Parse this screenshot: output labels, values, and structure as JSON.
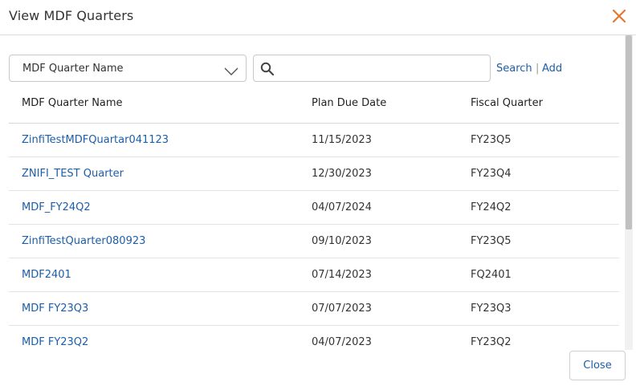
{
  "dialog": {
    "title": "View MDF Quarters",
    "close_icon": "close-x-icon",
    "accent_color": "#e8772e",
    "link_color": "#1c5ea8"
  },
  "filter": {
    "field_select": {
      "selected": "MDF Quarter Name",
      "icon": "chevron-down-icon"
    },
    "search_input": {
      "value": "",
      "placeholder": "",
      "icon": "search-icon"
    },
    "search_link": "Search",
    "separator": "|",
    "add_link": "Add"
  },
  "table": {
    "columns": [
      "MDF Quarter Name",
      "Plan Due Date",
      "Fiscal Quarter"
    ],
    "rows": [
      [
        "ZinfiTestMDFQuartar041123",
        "11/15/2023",
        "FY23Q5"
      ],
      [
        "ZNIFI_TEST Quarter",
        "12/30/2023",
        "FY23Q4"
      ],
      [
        "MDF_FY24Q2",
        "04/07/2024",
        "FY24Q2"
      ],
      [
        "ZinfiTestQuarter080923",
        "09/10/2023",
        "FY23Q5"
      ],
      [
        "MDF2401",
        "07/14/2023",
        "FQ2401"
      ],
      [
        "MDF FY23Q3",
        "07/07/2023",
        "FY23Q3"
      ],
      [
        "MDF FY23Q2",
        "04/07/2023",
        "FY23Q2"
      ]
    ]
  },
  "footer": {
    "close_label": "Close"
  }
}
